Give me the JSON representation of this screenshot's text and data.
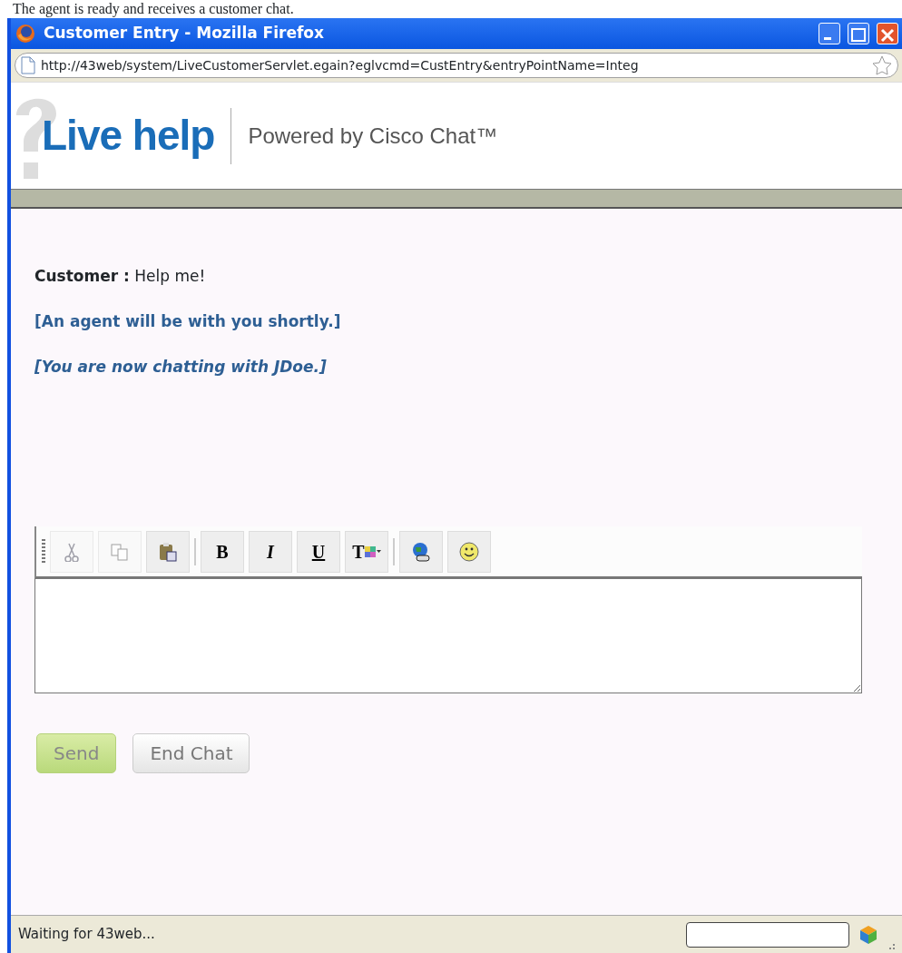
{
  "caption": "The agent is ready and receives a customer chat.",
  "window": {
    "title": "Customer Entry - Mozilla Firefox"
  },
  "address_bar": {
    "url": "http://43web/system/LiveCustomerServlet.egain?eglvcmd=CustEntry&entryPointName=Integ"
  },
  "header": {
    "logo": "Live help",
    "tagline": "Powered by Cisco Chat™"
  },
  "messages": [
    {
      "kind": "customer",
      "sender": "Customer :",
      "text": "Help me!"
    },
    {
      "kind": "notice",
      "text": "[An agent will be with you shortly.]"
    },
    {
      "kind": "status",
      "text": "[You are now chatting with JDoe.]"
    }
  ],
  "toolbar": {
    "groups": [
      [
        {
          "kind": "cut",
          "disabled": true
        },
        {
          "kind": "copy",
          "disabled": true
        },
        {
          "kind": "paste",
          "disabled": false
        }
      ],
      [
        {
          "kind": "bold",
          "label": "B",
          "disabled": false
        },
        {
          "kind": "italic",
          "label": "I",
          "disabled": false
        },
        {
          "kind": "underline",
          "label": "U",
          "disabled": false
        },
        {
          "kind": "textcolor",
          "label": "T",
          "disabled": false
        }
      ],
      [
        {
          "kind": "link",
          "disabled": false
        },
        {
          "kind": "smiley",
          "disabled": false
        }
      ]
    ]
  },
  "buttons": [
    {
      "kind": "send",
      "label": "Send"
    },
    {
      "kind": "end",
      "label": "End Chat"
    }
  ],
  "status_bar": {
    "text": "Waiting for 43web..."
  }
}
